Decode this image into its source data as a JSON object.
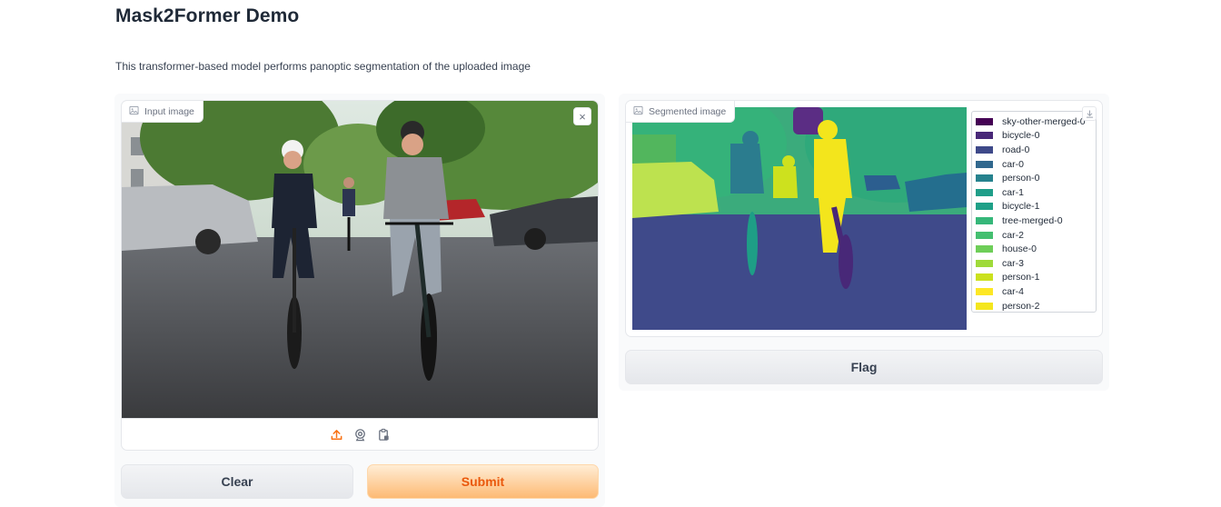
{
  "page": {
    "title": "Mask2Former Demo",
    "description": "This transformer-based model performs panoptic segmentation of the uploaded image"
  },
  "input": {
    "label": "Input image",
    "label_icon": "image-icon",
    "close": "×",
    "toolbar": [
      {
        "name": "upload-icon",
        "color": "#f97316"
      },
      {
        "name": "webcam-icon",
        "color": "#6b7280"
      },
      {
        "name": "clipboard-icon",
        "color": "#6b7280"
      }
    ]
  },
  "output": {
    "label": "Segmented image",
    "label_icon": "image-icon",
    "download_icon": "download-icon"
  },
  "legend": [
    {
      "label": "sky-other-merged-0",
      "color": "#440154"
    },
    {
      "label": "bicycle-0",
      "color": "#482878"
    },
    {
      "label": "road-0",
      "color": "#3e4989"
    },
    {
      "label": "car-0",
      "color": "#31688e"
    },
    {
      "label": "person-0",
      "color": "#26828e"
    },
    {
      "label": "car-1",
      "color": "#1f9e89"
    },
    {
      "label": "bicycle-1",
      "color": "#1fa088"
    },
    {
      "label": "tree-merged-0",
      "color": "#35b779"
    },
    {
      "label": "car-2",
      "color": "#44bf70"
    },
    {
      "label": "house-0",
      "color": "#6ece58"
    },
    {
      "label": "car-3",
      "color": "#9fda3a"
    },
    {
      "label": "person-1",
      "color": "#cbe11e"
    },
    {
      "label": "car-4",
      "color": "#fde725"
    },
    {
      "label": "person-2",
      "color": "#f4e61e"
    }
  ],
  "buttons": {
    "clear": "Clear",
    "submit": "Submit",
    "flag": "Flag"
  },
  "colors": {
    "accent": "#f97316",
    "primary_text": "#ea580c"
  }
}
